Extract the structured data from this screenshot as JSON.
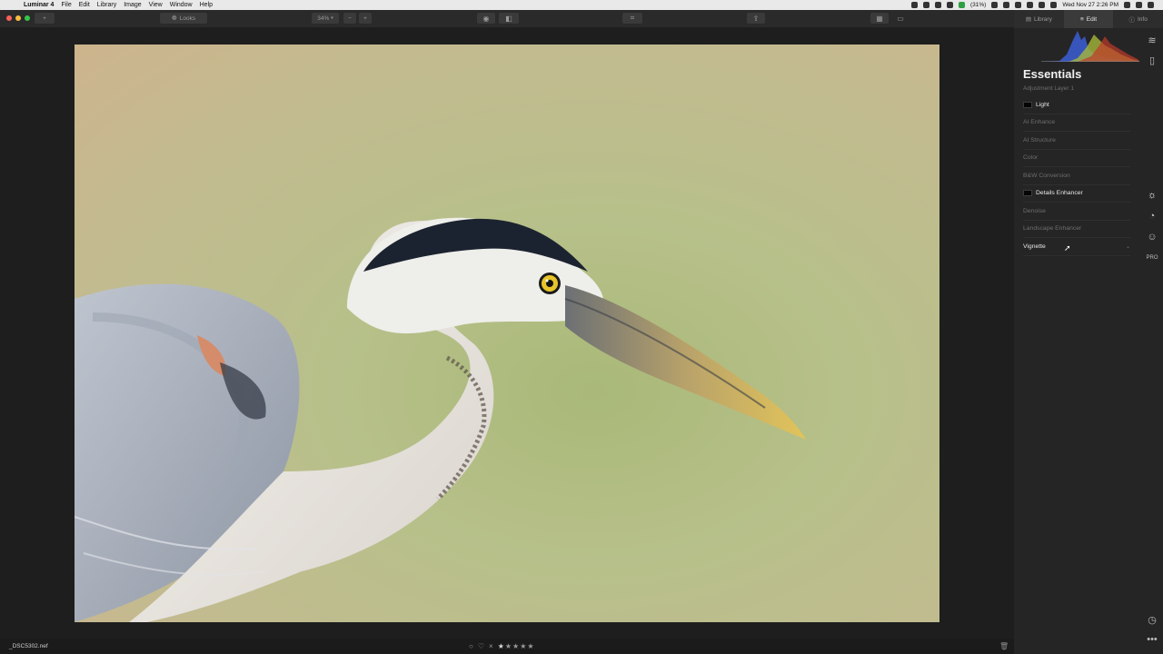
{
  "menubar": {
    "app_name": "Luminar 4",
    "menus": [
      "File",
      "Edit",
      "Library",
      "Image",
      "View",
      "Window",
      "Help"
    ],
    "battery": "(31%)",
    "clock": "Wed Nov 27  2:26 PM"
  },
  "toolbar": {
    "add_label": "+",
    "looks_label": "Looks",
    "zoom_label": "34%",
    "zoom_out": "−",
    "zoom_in": "+"
  },
  "photo": {
    "filename": "_DSC5302.nef",
    "rating_max": 5,
    "rating_value": 1
  },
  "panel": {
    "tabs": [
      {
        "label": "Library",
        "icon": "library-icon"
      },
      {
        "label": "Edit",
        "icon": "edit-sliders-icon"
      },
      {
        "label": "Info",
        "icon": "info-icon"
      }
    ],
    "title": "Essentials",
    "layer": "Adjustment Layer 1",
    "tools": [
      {
        "label": "Light",
        "active": true,
        "swatch": true
      },
      {
        "label": "AI Enhance",
        "active": false
      },
      {
        "label": "AI Structure",
        "active": false
      },
      {
        "label": "Color",
        "active": false
      },
      {
        "label": "B&W Conversion",
        "active": false
      },
      {
        "label": "Details Enhancer",
        "active": true,
        "swatch": true
      },
      {
        "label": "Denoise",
        "active": false
      },
      {
        "label": "Landscape Enhancer",
        "active": false
      },
      {
        "label": "Vignette",
        "active": true
      }
    ],
    "pro_badge": "PRO"
  },
  "colors": {
    "accent": "#3b8fd6",
    "panel_bg": "#252525",
    "close": "#fc605c",
    "minimize": "#fdbc40",
    "zoom": "#34c84a"
  }
}
